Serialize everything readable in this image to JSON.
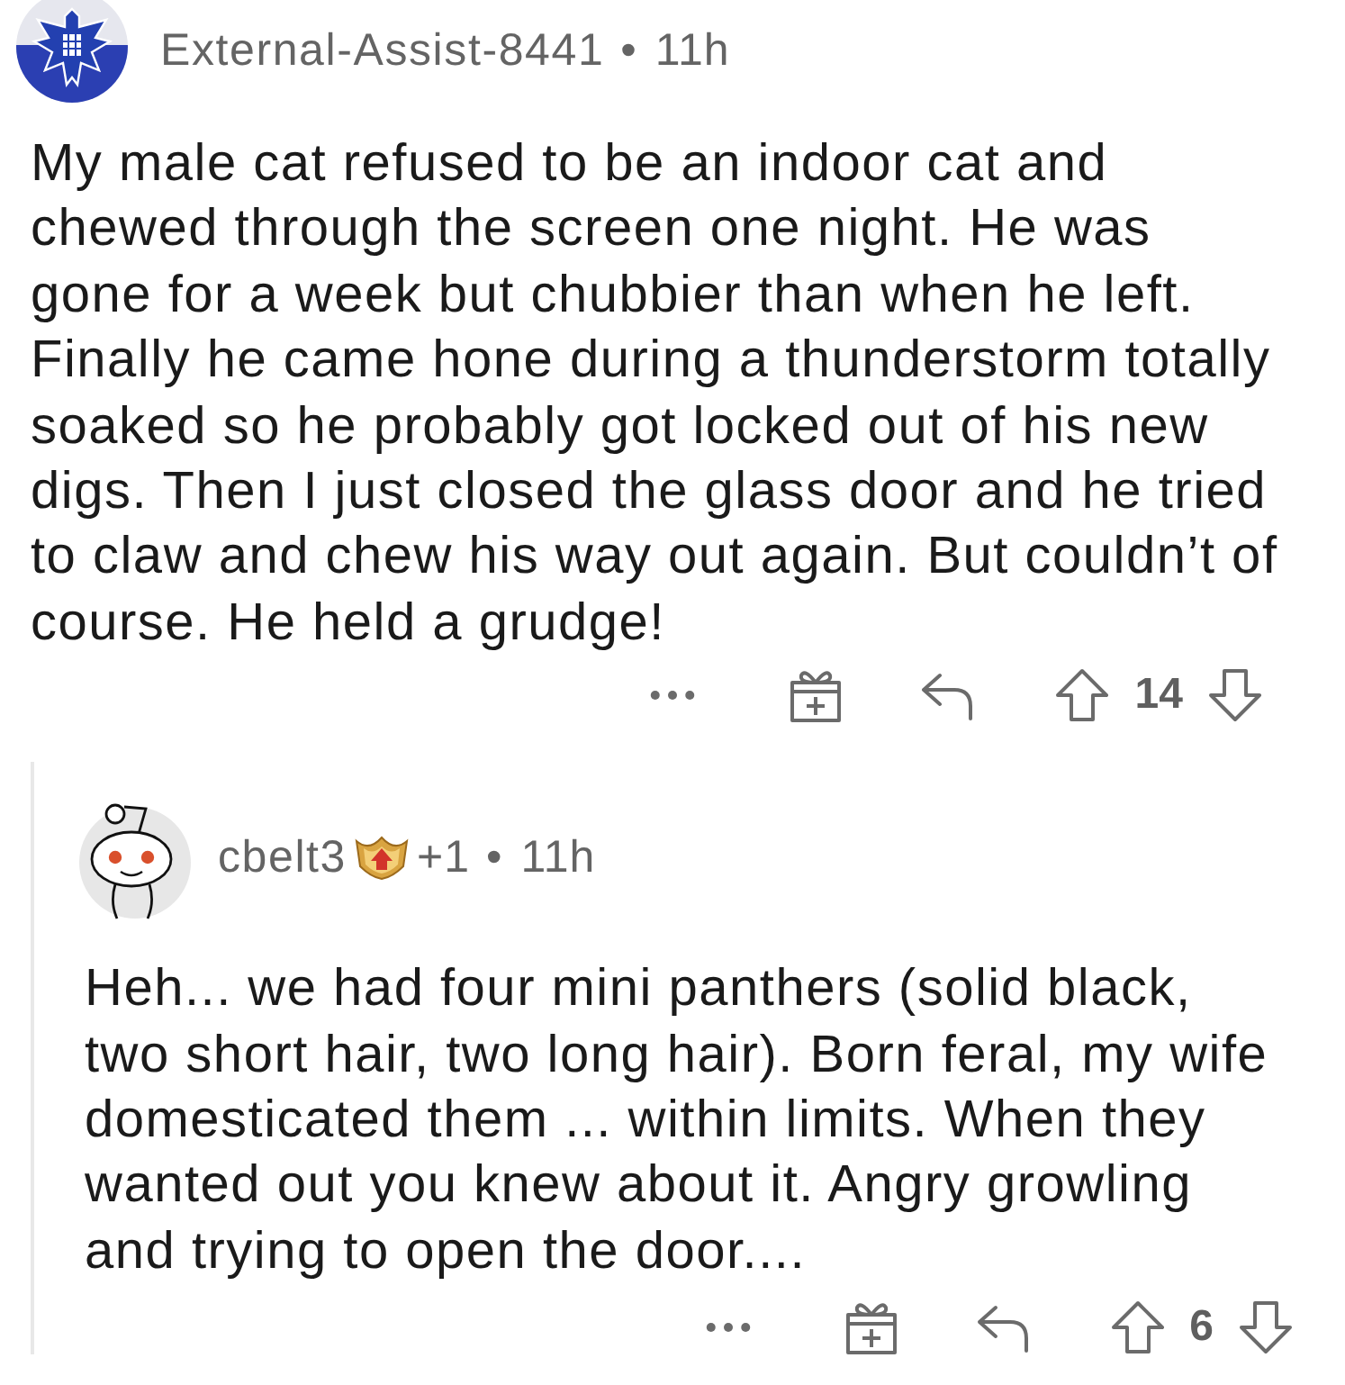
{
  "comments": [
    {
      "author": "External-Assist-8441",
      "avatar": {
        "kind": "emblem"
      },
      "separator": "•",
      "time": "11h",
      "body": "My male cat refused to be an indoor cat and\nchewed through the screen one night. He was\ngone for a week but chubbier than when he left.\nFinally he came hone during a thunderstorm totally\nsoaked so he probably got locked out of his new\ndigs. Then I just closed the glass door and he tried\nto claw and chew his way out again. But couldn’t of\ncourse. He held a grudge!",
      "score": "14",
      "replies": [
        {
          "author": "cbelt3",
          "avatar": {
            "kind": "default"
          },
          "award_count": "+1",
          "separator": "•",
          "time": "11h",
          "body": "Heh... we had four mini panthers (solid black,\ntwo short hair, two long hair). Born feral, my wife\ndomesticated them ... within limits. When they\nwanted out you knew about it. Angry growling\nand trying to open the door....",
          "score": "6"
        }
      ]
    }
  ]
}
